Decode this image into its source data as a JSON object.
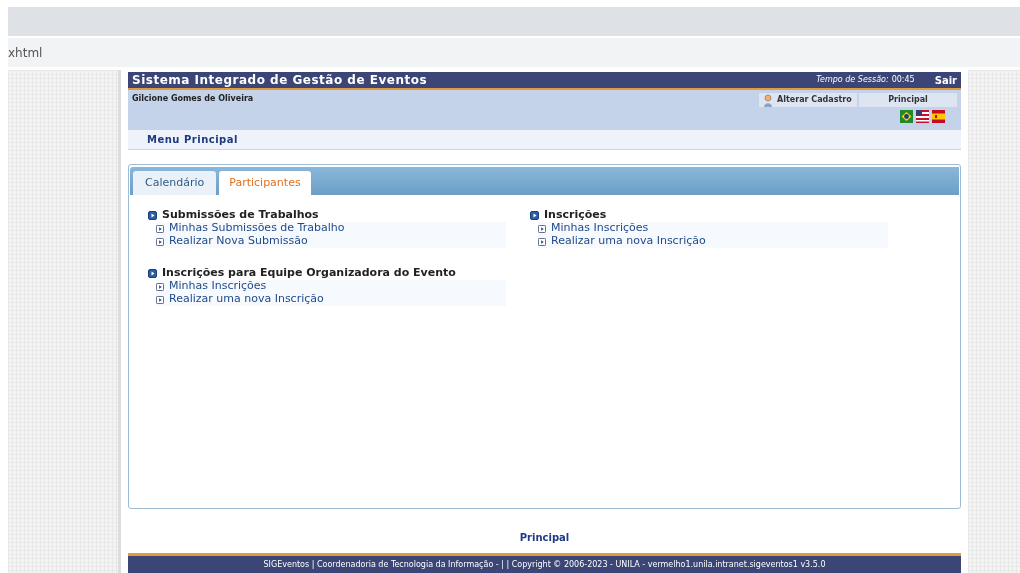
{
  "browser": {
    "address": "xhtml"
  },
  "header": {
    "title": "Sistema Integrado de Gestão de Eventos",
    "session_label": "Tempo de Sessão:",
    "session_time": "00:45",
    "logout": "Sair",
    "user": "Gilcione Gomes de Oliveira",
    "edit_profile": "Alterar Cadastro",
    "home": "Principal"
  },
  "menu_title": "Menu Principal",
  "tabs": [
    {
      "label": "Calendário",
      "selected": false
    },
    {
      "label": "Participantes",
      "selected": true
    }
  ],
  "columns": [
    [
      {
        "title": "Submissões de Trabalhos",
        "links": [
          "Minhas Submissões de Trabalho",
          "Realizar Nova Submissão"
        ]
      },
      {
        "title": "Inscrições para Equipe Organizadora do Evento",
        "links": [
          "Minhas Inscrições",
          "Realizar uma nova Inscrição"
        ]
      }
    ],
    [
      {
        "title": "Inscrições",
        "links": [
          "Minhas Inscrições",
          "Realizar uma nova Inscrição"
        ]
      }
    ]
  ],
  "footer_link": "Principal",
  "footer": "SIGEventos | Coordenadoria de Tecnologia da Informação - | | Copyright © 2006-2023 - UNILA - vermelho1.unila.intranet.sigeventos1 v3.5.0"
}
